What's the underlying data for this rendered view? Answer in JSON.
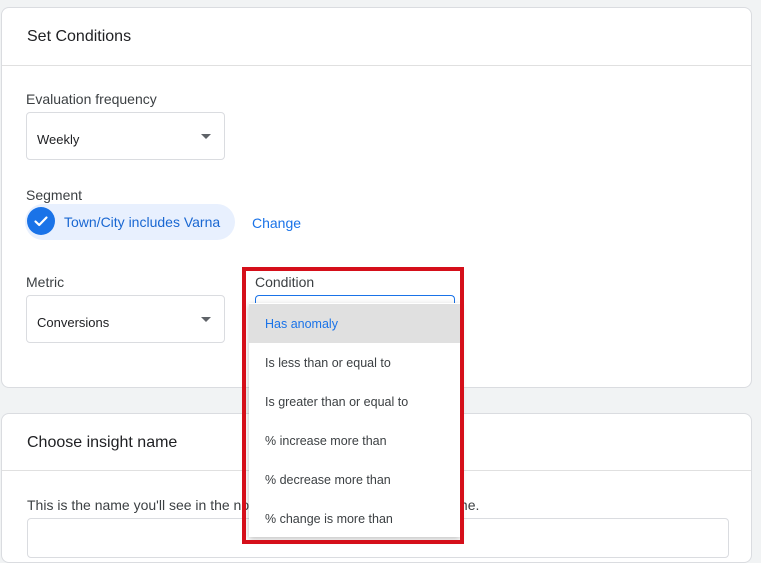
{
  "set_conditions": {
    "title": "Set Conditions",
    "evaluation_frequency": {
      "label": "Evaluation frequency",
      "value": "Weekly"
    },
    "segment": {
      "label": "Segment",
      "chip": "Town/City includes Varna",
      "change_link": "Change"
    },
    "metric": {
      "label": "Metric",
      "value": "Conversions"
    },
    "condition": {
      "label": "Condition",
      "options": [
        "Has anomaly",
        "Is less than or equal to",
        "Is greater than or equal to",
        "% increase more than",
        "% decrease more than",
        "% change is more than"
      ],
      "selected": "Has anomaly"
    }
  },
  "insight_name": {
    "title": "Choose insight name",
    "helper_visible_start": "This is the name you'll see in the not",
    "helper_visible_end": "me."
  },
  "colors": {
    "accent": "#1a73e8",
    "highlight_border": "#d50f1a"
  },
  "icons": {
    "segment_check": "check-icon",
    "dropdown_caret": "chevron-down-icon"
  }
}
